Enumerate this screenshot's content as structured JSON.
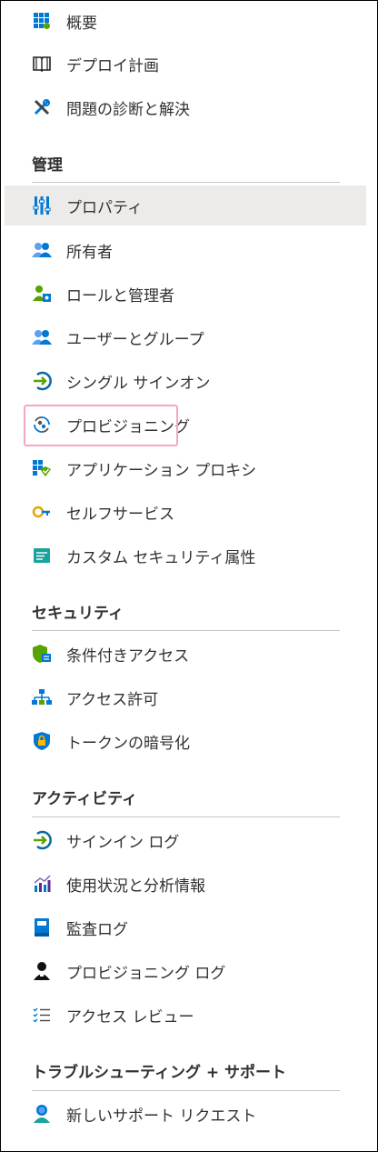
{
  "top_items": [
    {
      "label": "概要",
      "icon": "overview-grid-icon"
    },
    {
      "label": "デプロイ計画",
      "icon": "book-icon"
    },
    {
      "label": "問題の診断と解決",
      "icon": "wrench-icon"
    }
  ],
  "sections": {
    "manage": {
      "title": "管理",
      "items": [
        {
          "label": "プロパティ",
          "icon": "properties-bars-icon"
        },
        {
          "label": "所有者",
          "icon": "users-icon"
        },
        {
          "label": "ロールと管理者",
          "icon": "user-admin-icon"
        },
        {
          "label": "ユーザーとグループ",
          "icon": "users-groups-icon"
        },
        {
          "label": "シングル サインオン",
          "icon": "signin-arrow-icon"
        },
        {
          "label": "プロビジョニング",
          "icon": "provisioning-icon"
        },
        {
          "label": "アプリケーション プロキシ",
          "icon": "app-proxy-icon"
        },
        {
          "label": "セルフサービス",
          "icon": "self-service-key-icon"
        },
        {
          "label": "カスタム セキュリティ属性",
          "icon": "custom-attributes-icon"
        }
      ]
    },
    "security": {
      "title": "セキュリティ",
      "items": [
        {
          "label": "条件付きアクセス",
          "icon": "conditional-access-shield-icon"
        },
        {
          "label": "アクセス許可",
          "icon": "permissions-hierarchy-icon"
        },
        {
          "label": "トークンの暗号化",
          "icon": "token-encryption-shield-icon"
        }
      ]
    },
    "activity": {
      "title": "アクティビティ",
      "items": [
        {
          "label": "サインイン ログ",
          "icon": "signin-log-icon"
        },
        {
          "label": "使用状況と分析情報",
          "icon": "usage-insights-chart-icon"
        },
        {
          "label": "監査ログ",
          "icon": "audit-log-book-icon"
        },
        {
          "label": "プロビジョニング ログ",
          "icon": "provisioning-log-user-icon"
        },
        {
          "label": "アクセス レビュー",
          "icon": "access-review-list-icon"
        }
      ]
    },
    "support": {
      "title": "トラブルシューティング + サポート",
      "items": [
        {
          "label": "新しいサポート リクエスト",
          "icon": "support-request-person-icon"
        }
      ]
    }
  },
  "selected_item": "プロパティ",
  "highlighted_item": "プロビジョニング",
  "colors": {
    "selected_bg": "#edebe9",
    "highlight_border": "#f5a6c8",
    "accent_blue": "#0078d4",
    "accent_green": "#57a300"
  }
}
